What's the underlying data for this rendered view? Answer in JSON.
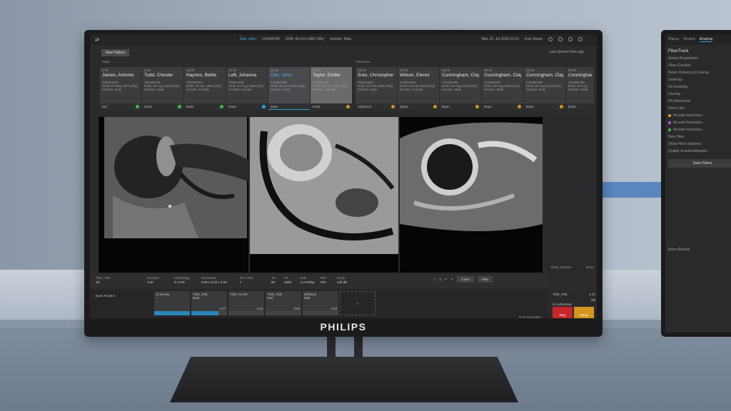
{
  "topbar": {
    "patient_name": "Doe, John",
    "patient_id": "123456789",
    "dob": "DOB: 06-Oct-1980 (38y)",
    "gender": "Gender: Male",
    "datetime": "Mon 25, Jul 2018  23:10",
    "user": "User Name"
  },
  "toolbar": {
    "new_patient": "New Patient",
    "last_synced": "Last synced 6min ago"
  },
  "day_labels": {
    "today": "Today",
    "tomorrow": "Tomorrow"
  },
  "cards": [
    {
      "time": "9:00",
      "name": "James, Antonio",
      "id": "876823546",
      "dob": "DOB: 07-May-1979 (39y)",
      "gender": "Gender: Male",
      "exam": "Ear"
    },
    {
      "time": "9:30",
      "name": "Todd, Chester",
      "id": "765489754",
      "dob": "DOB: 22-Aug-1989 (29y)",
      "gender": "Gender: Male",
      "exam": "Knee"
    },
    {
      "time": "10:00",
      "name": "Haynes, Bettie",
      "id": "765489754",
      "dob": "DOB: 18-Apr-1983 (35y)",
      "gender": "Gender: Female",
      "exam": "Brain"
    },
    {
      "time": "10:30",
      "name": "Left, Johanna",
      "id": "786624234",
      "dob": "DOB: 24-Aug-1986 (32y)",
      "gender": "Gender: Female",
      "exam": "Heart"
    },
    {
      "time": "11:30",
      "name": "Doe, John",
      "id": "123456789",
      "dob": "DOB: 06-Oct-1980 (38y)",
      "gender": "Gender: Male",
      "exam": "Brain"
    },
    {
      "time": "12:00",
      "name": "Taylor, Emilie",
      "id": "876824535",
      "dob": "DOB: 16-Apr-1983 (35y)",
      "gender": "Gender: Female",
      "exam": "Knee"
    },
    {
      "time": "08:00",
      "name": "Soto, Christopher",
      "id": "763534534",
      "dob": "DOB: 13-Feb-1969 (49y)",
      "gender": "Gender: Male",
      "exam": "Abdomen"
    },
    {
      "time": "08:30",
      "name": "Wilson, Elenor",
      "id": "310034654",
      "dob": "DOB: 13-Feb-1963 (55y)",
      "gender": "Gender: Female",
      "exam": "Spine"
    },
    {
      "time": "08:30",
      "name": "Cunningham, Clayton",
      "id": "123456789",
      "dob": "DOB: 24-Aug-2018 (32y)",
      "gender": "Gender: Male",
      "exam": "Brain"
    },
    {
      "time": "08:30",
      "name": "Cunningham, Clayton",
      "id": "123456789",
      "dob": "DOB: 24-Aug-2018 (32y)",
      "gender": "Gender: Male",
      "exam": "Brain"
    },
    {
      "time": "08:30",
      "name": "Cunningham, Clayton",
      "id": "123456789",
      "dob": "DOB: 24-Aug-2018 (32y)",
      "gender": "Gender: Male",
      "exam": "Brain"
    },
    {
      "time": "08:30",
      "name": "Cunningham",
      "id": "123456789",
      "dob": "DOB: 24-Aug",
      "gender": "Gender: Male",
      "exam": "Brain"
    }
  ],
  "sidepanel": {
    "protocol_label": "Brain_Routine",
    "protocol_time": "09:44",
    "scan_label": "T2W_TSE",
    "scan_time": "1:27",
    "scan_count": "2/5",
    "authorized": "Authorized",
    "stop": "Stop",
    "pause": "Pause"
  },
  "params": [
    {
      "label": "T2W_TSE",
      "value": "3d"
    },
    {
      "label": "Duration",
      "value": "3:30"
    },
    {
      "label": "Physiology",
      "value": "8 x 8 t8"
    },
    {
      "label": "Resolution",
      "value": "0.60 x 0.40 x 3.00"
    },
    {
      "label": "Rel. SNR",
      "value": "1"
    },
    {
      "label": "TE",
      "value": "80"
    },
    {
      "label": "TR",
      "value": "1500"
    },
    {
      "label": "SAR",
      "value": "<1.8 W/kg"
    },
    {
      "label": "PNS",
      "value": "70%"
    },
    {
      "label": "Noise",
      "value": "140 dB"
    }
  ],
  "controls": {
    "close": "Close",
    "plan": "Plan"
  },
  "queue": {
    "label": "Brain Routine",
    "items": [
      {
        "name": "1) Survey",
        "sub": "",
        "time": "",
        "progress": 1.0
      },
      {
        "name": "T2W_TSE",
        "sub": "Dark",
        "time": "1:27",
        "progress": 0.75
      },
      {
        "name": "T2W_FLAIR",
        "sub": "",
        "time": "4:12",
        "progress": 0.0
      },
      {
        "name": "T1W_TSE",
        "sub": "Intel",
        "time": "3:02",
        "progress": 0.0
      },
      {
        "name": "Diffusion",
        "sub": "Mild",
        "time": "2:10",
        "progress": 0.0
      }
    ],
    "end_acquisition": "End Acquisition"
  },
  "brand": "PHILIPS",
  "monitor2": {
    "tabs": [
      "Planes",
      "Review",
      "Analysis"
    ],
    "title": "FiberTrack",
    "rows": [
      "Series Registration",
      "Fiber Creation",
      "Beam Ordering & Overlay",
      "Underlay",
      "No Underlay",
      "Overlay",
      "FA Directional",
      "Fiber Lists",
      "Arcuate fasciculus",
      "Arcuate fasciculus",
      "Arcuate fasciculus",
      "New Fiber",
      "Show Fiber Statistics",
      "Quality of automatization"
    ],
    "save": "Save Fibers",
    "bottom": "Brain Routine"
  }
}
